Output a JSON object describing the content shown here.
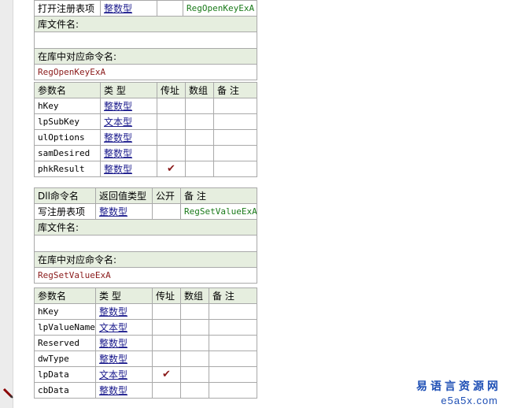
{
  "block1": {
    "cmd_row": {
      "name": "打开注册表项",
      "ret": "整数型",
      "public": "",
      "note": "RegOpenKeyExA"
    },
    "lib_label": "库文件名:",
    "lib_value": "",
    "lib_cmd_label": "在库中对应命令名:",
    "lib_cmd_value": "RegOpenKeyExA",
    "param_headers": {
      "name": "参数名",
      "type": "类 型",
      "byref": "传址",
      "array": "数组",
      "note": "备 注"
    },
    "params": [
      {
        "name": "hKey",
        "type": "整数型",
        "byref": ""
      },
      {
        "name": "lpSubKey",
        "type": "文本型",
        "byref": ""
      },
      {
        "name": "ulOptions",
        "type": "整数型",
        "byref": ""
      },
      {
        "name": "samDesired",
        "type": "整数型",
        "byref": ""
      },
      {
        "name": "phkResult",
        "type": "整数型",
        "byref": "✔"
      }
    ]
  },
  "block2": {
    "cmd_headers": {
      "name": "Dll命令名",
      "ret": "返回值类型",
      "public": "公开",
      "note": "备 注"
    },
    "cmd_row": {
      "name": "写注册表项",
      "ret": "整数型",
      "public": "",
      "note": "RegSetValueExA"
    },
    "lib_label": "库文件名:",
    "lib_value": "",
    "lib_cmd_label": "在库中对应命令名:",
    "lib_cmd_value": "RegSetValueExA",
    "param_headers": {
      "name": "参数名",
      "type": "类 型",
      "byref": "传址",
      "array": "数组",
      "note": "备 注"
    },
    "params": [
      {
        "name": "hKey",
        "type": "整数型",
        "byref": ""
      },
      {
        "name": "lpValueName",
        "type": "文本型",
        "byref": ""
      },
      {
        "name": "Reserved",
        "type": "整数型",
        "byref": ""
      },
      {
        "name": "dwType",
        "type": "整数型",
        "byref": ""
      },
      {
        "name": "lpData",
        "type": "文本型",
        "byref": "✔"
      },
      {
        "name": "cbData",
        "type": "整数型",
        "byref": ""
      }
    ]
  },
  "watermark": {
    "title": "易语言资源网",
    "url": "e5a5x.com"
  }
}
